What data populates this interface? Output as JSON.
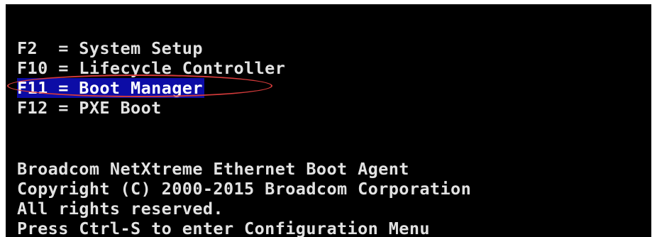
{
  "boot_menu": {
    "items": [
      {
        "text": "F2  = System Setup"
      },
      {
        "text": "F10 = Lifecycle Controller"
      },
      {
        "text": "F11 = Boot Manager"
      },
      {
        "text": "F12 = PXE Boot"
      }
    ],
    "selected_index": 2
  },
  "nic_banner": {
    "lines": [
      "Broadcom NetXtreme Ethernet Boot Agent",
      "Copyright (C) 2000-2015 Broadcom Corporation",
      "All rights reserved.",
      "Press Ctrl-S to enter Configuration Menu"
    ]
  },
  "colors": {
    "background": "#000000",
    "text": "#e2e2e2",
    "selection_bg": "#0c0ca6",
    "annotation_ring": "#d43b3b"
  }
}
